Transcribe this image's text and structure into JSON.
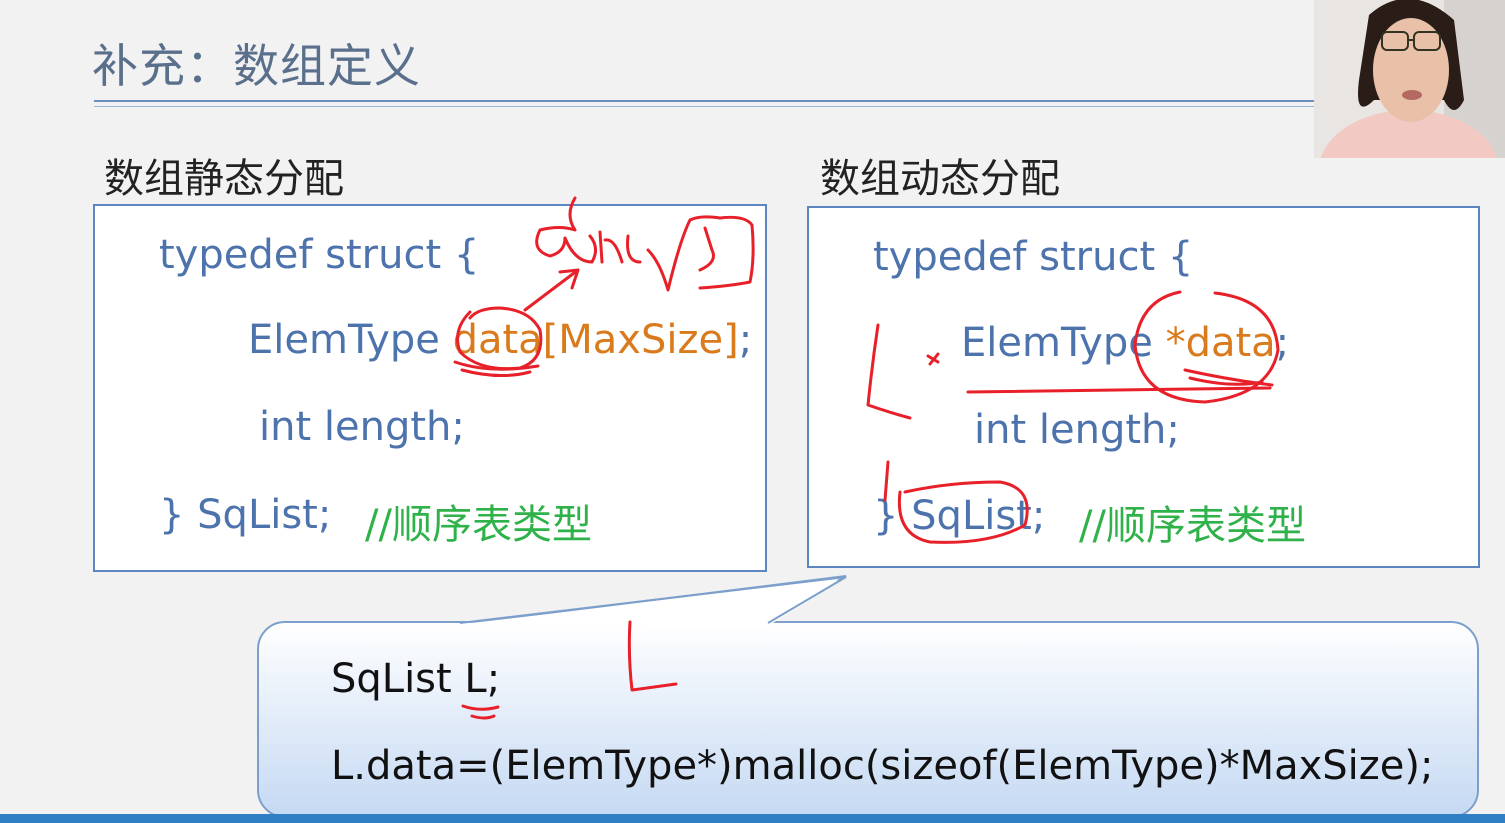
{
  "slide": {
    "title": "补充：数组定义"
  },
  "static_alloc": {
    "heading": "数组静态分配",
    "line1": "typedef struct {",
    "line2_type": "ElemType ",
    "line2_field": "data[MaxSize]",
    "line2_end": ";",
    "line3": "int length;",
    "line4": "} SqList;",
    "comment": "//顺序表类型"
  },
  "dynamic_alloc": {
    "heading": "数组动态分配",
    "line1": "typedef struct {",
    "line2_type": "ElemType ",
    "line2_field": "*data",
    "line2_end": ";",
    "line3": "int length;",
    "line4": "} SqList;",
    "comment": "//顺序表类型"
  },
  "callout": {
    "line1": "SqList L;",
    "line2": "L.data=(ElemType*)malloc(sizeof(ElemType)*MaxSize);"
  },
  "colors": {
    "code_blue": "#4d73ad",
    "code_orange": "#d97a1c",
    "comment_green": "#2fb24a",
    "annotation_red": "#e8202a"
  },
  "annotations": {
    "kind": "handwritten red pen marks"
  }
}
